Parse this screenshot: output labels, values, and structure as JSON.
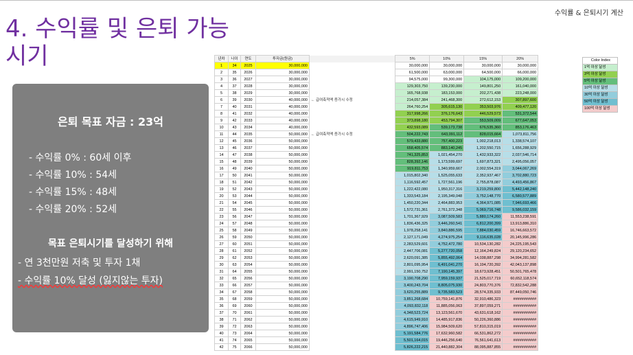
{
  "header": {
    "corner_label": "수익률 & 은퇴시기 계산"
  },
  "title": {
    "line1": "4. 수익률 및 은퇴 가능",
    "line2": "시기"
  },
  "summary": {
    "goal": "은퇴 목표 자금 : 23억",
    "rates": [
      "- 수익률   0% : 60세 이후",
      "- 수익률 10% : 54세",
      "- 수익률 15% : 48세",
      "- 수익률 20% : 52세"
    ],
    "how_title": "목표 은퇴시기를 달성하기 위해",
    "how_items": [
      "- 연 3천만원 저축 및 투자 1채",
      "- 수익률 10% 달성 (잃지않는 투자)"
    ],
    "colors": {
      "box": "#7f7f7f",
      "title": "#7030a0"
    }
  },
  "sheet": {
    "headers": [
      "년차",
      "나이",
      "연도",
      "투자금(원금)",
      "5%",
      "10%",
      "15%",
      "20%"
    ],
    "notes": {
      "row6": "← 급여축적액 증가시 수정",
      "row11": "← 급여축적액 증가시 수정"
    },
    "rows": [
      [
        "1",
        "34",
        "2025",
        "30,000,000",
        "30,000,000",
        "30,000,000",
        "30,000,000",
        "30,000,000"
      ],
      [
        "2",
        "35",
        "2026",
        "30,000,000",
        "61,500,000",
        "63,000,000",
        "64,500,000",
        "66,000,000"
      ],
      [
        "3",
        "36",
        "2027",
        "30,000,000",
        "94,575,000",
        "99,300,000",
        "104,175,000",
        "109,200,000"
      ],
      [
        "4",
        "37",
        "2028",
        "30,000,000",
        "129,303,750",
        "139,230,000",
        "149,801,250",
        "161,040,000"
      ],
      [
        "5",
        "38",
        "2029",
        "30,000,000",
        "165,768,938",
        "183,153,000",
        "202,271,438",
        "223,248,000"
      ],
      [
        "6",
        "39",
        "2030",
        "40,000,000",
        "214,057,384",
        "241,468,300",
        "272,612,153",
        "307,897,600"
      ],
      [
        "7",
        "40",
        "2031",
        "40,000,000",
        "264,760,254",
        "305,615,130",
        "353,503,976",
        "409,477,120"
      ],
      [
        "8",
        "41",
        "2032",
        "40,000,000",
        "317,998,266",
        "376,176,643",
        "446,529,573",
        "531,372,544"
      ],
      [
        "9",
        "42",
        "2033",
        "40,000,000",
        "373,898,180",
        "453,794,307",
        "553,509,009",
        "677,647,053"
      ],
      [
        "10",
        "43",
        "2034",
        "40,000,000",
        "432,593,089",
        "539,173,738",
        "676,535,360",
        "853,176,463"
      ],
      [
        "11",
        "44",
        "2035",
        "50,000,000",
        "504,222,743",
        "643,091,112",
        "828,015,664",
        "1,073,811,756"
      ],
      [
        "12",
        "45",
        "2036",
        "50,000,000",
        "579,433,880",
        "757,400,223",
        "1,002,218,013",
        "1,338,574,107"
      ],
      [
        "13",
        "46",
        "2037",
        "50,000,000",
        "658,405,574",
        "883,140,245",
        "1,202,550,715",
        "1,656,288,929"
      ],
      [
        "14",
        "47",
        "2038",
        "50,000,000",
        "741,325,853",
        "1,021,454,270",
        "1,432,933,322",
        "2,037,546,714"
      ],
      [
        "15",
        "48",
        "2039",
        "50,000,000",
        "828,392,146",
        "1,173,599,697",
        "1,697,873,321",
        "2,495,056,057"
      ],
      [
        "16",
        "49",
        "2040",
        "50,000,000",
        "919,811,753",
        "1,340,959,667",
        "2,002,554,319",
        "3,044,067,269"
      ],
      [
        "17",
        "50",
        "2041",
        "50,000,000",
        "1,015,802,340",
        "1,525,055,633",
        "2,352,937,467",
        "3,702,880,723"
      ],
      [
        "18",
        "51",
        "2042",
        "50,000,000",
        "1,116,592,457",
        "1,727,561,196",
        "2,755,878,087",
        "4,493,456,867"
      ],
      [
        "19",
        "52",
        "2043",
        "50,000,000",
        "1,222,422,080",
        "1,950,317,316",
        "3,219,259,800",
        "5,442,148,240"
      ],
      [
        "20",
        "53",
        "2044",
        "50,000,000",
        "1,333,543,184",
        "2,195,349,048",
        "3,752,148,770",
        "6,580,577,889"
      ],
      [
        "21",
        "54",
        "2045",
        "50,000,000",
        "1,450,220,344",
        "2,464,883,953",
        "4,364,971,085",
        "7,946,693,466"
      ],
      [
        "22",
        "55",
        "2046",
        "50,000,000",
        "1,572,731,361",
        "2,761,372,348",
        "5,069,716,748",
        "9,586,032,159"
      ],
      [
        "23",
        "56",
        "2047",
        "50,000,000",
        "1,701,367,929",
        "3,087,509,583",
        "5,880,174,260",
        "11,553,238,591"
      ],
      [
        "24",
        "57",
        "2048",
        "50,000,000",
        "1,836,436,325",
        "3,446,260,541",
        "6,812,200,399",
        "13,913,886,310"
      ],
      [
        "25",
        "58",
        "2049",
        "50,000,000",
        "1,978,258,141",
        "3,840,886,595",
        "7,884,030,459",
        "16,746,663,572"
      ],
      [
        "26",
        "59",
        "2050",
        "50,000,000",
        "2,127,171,049",
        "4,274,975,254",
        "9,116,635,028",
        "20,145,996,286"
      ],
      [
        "27",
        "60",
        "2051",
        "50,000,000",
        "2,283,529,601",
        "4,752,472,780",
        "10,534,130,282",
        "24,225,195,543"
      ],
      [
        "28",
        "61",
        "2052",
        "50,000,000",
        "2,447,706,081",
        "5,277,720,058",
        "12,164,249,824",
        "29,120,234,652"
      ],
      [
        "29",
        "62",
        "2053",
        "50,000,000",
        "2,620,091,385",
        "5,855,492,064",
        "14,038,887,298",
        "34,994,281,582"
      ],
      [
        "30",
        "63",
        "2054",
        "50,000,000",
        "2,801,095,954",
        "6,491,041,270",
        "16,194,720,392",
        "42,043,137,898"
      ],
      [
        "31",
        "64",
        "2055",
        "50,000,000",
        "2,991,150,752",
        "7,190,145,397",
        "18,673,928,451",
        "50,501,765,478"
      ],
      [
        "32",
        "65",
        "2056",
        "50,000,000",
        "3,190,708,290",
        "7,959,159,937",
        "21,525,017,719",
        "60,652,118,574"
      ],
      [
        "33",
        "66",
        "2057",
        "50,000,000",
        "3,400,243,704",
        "8,805,075,930",
        "24,803,770,376",
        "72,832,542,288"
      ],
      [
        "34",
        "67",
        "2058",
        "50,000,000",
        "3,620,255,889",
        "9,735,583,523",
        "28,574,335,933",
        "87,449,050,746"
      ],
      [
        "35",
        "68",
        "2059",
        "50,000,000",
        "3,851,268,684",
        "10,759,141,876",
        "32,910,486,323",
        "###########"
      ],
      [
        "36",
        "69",
        "2060",
        "50,000,000",
        "4,093,832,118",
        "11,885,056,063",
        "37,897,059,271",
        "###########"
      ],
      [
        "37",
        "70",
        "2061",
        "50,000,000",
        "4,348,523,724",
        "13,123,561,670",
        "43,631,618,162",
        "###########"
      ],
      [
        "38",
        "71",
        "2062",
        "50,000,000",
        "4,615,949,910",
        "14,485,917,836",
        "50,226,360,886",
        "###########"
      ],
      [
        "39",
        "72",
        "2063",
        "50,000,000",
        "4,896,747,406",
        "15,984,509,620",
        "57,810,315,019",
        "###########"
      ],
      [
        "40",
        "73",
        "2064",
        "50,000,000",
        "5,191,584,776",
        "17,632,960,582",
        "66,531,862,272",
        "###########"
      ],
      [
        "41",
        "74",
        "2065",
        "50,000,000",
        "5,501,164,015",
        "19,446,256,640",
        "76,561,641,613",
        "###########"
      ],
      [
        "42",
        "75",
        "2066",
        "50,000,000",
        "5,826,222,215",
        "21,440,882,304",
        "88,095,887,855",
        "###########"
      ]
    ],
    "legend": {
      "title": "Color Index",
      "items": [
        {
          "label": "1억 이상 달성",
          "color": "#c6efce"
        },
        {
          "label": "3억 이상 달성",
          "color": "#92d050"
        },
        {
          "label": "5억 이상 달성",
          "color": "#63be7b"
        },
        {
          "label": "10억 이상 달성",
          "color": "#b7dee8"
        },
        {
          "label": "30억 이상 달성",
          "color": "#92cddc"
        },
        {
          "label": "50억 이상 달성",
          "color": "#6fbfd0"
        },
        {
          "label": "100억 이상 달성",
          "color": "#f4cccc"
        }
      ]
    }
  }
}
